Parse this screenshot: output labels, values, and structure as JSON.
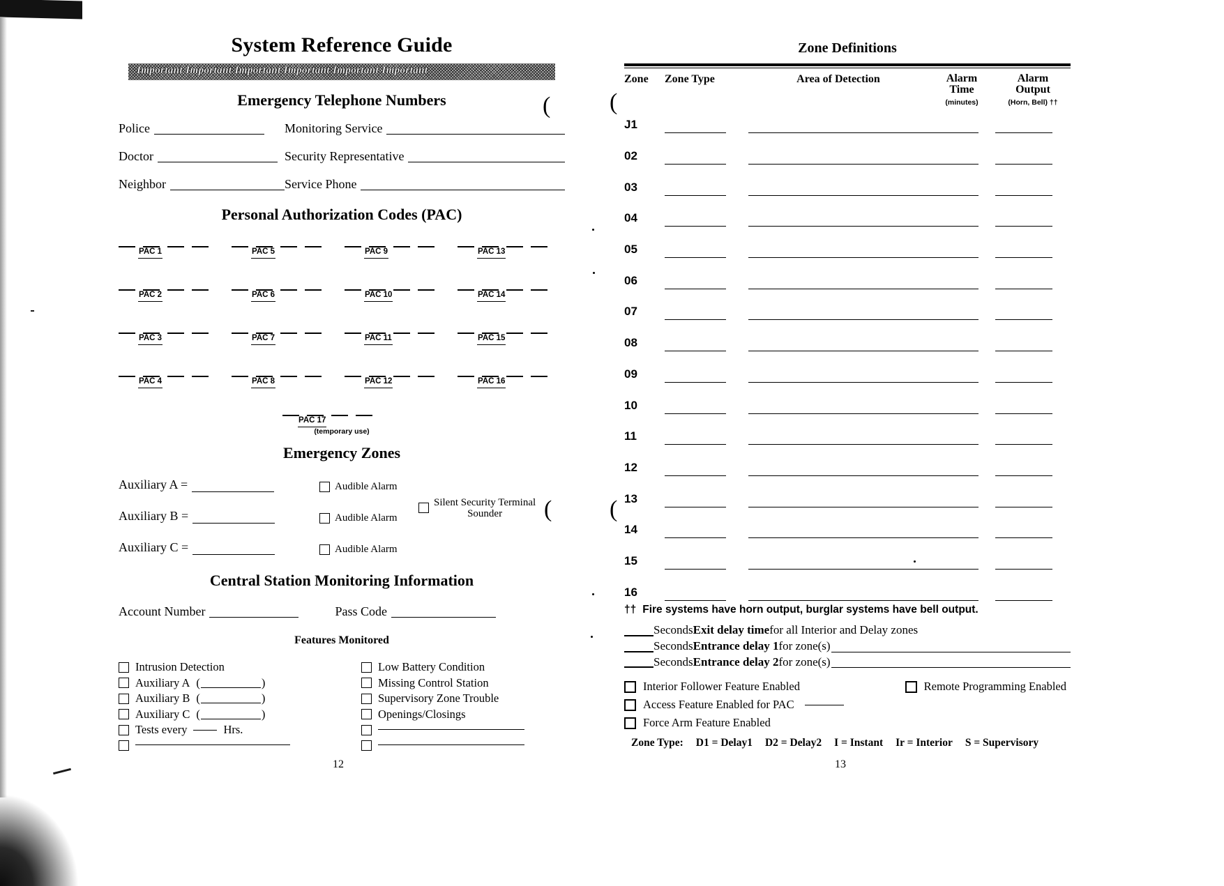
{
  "document": {
    "title": "System Reference Guide",
    "important_banner": "Important  Important  Important  Important  Important  Important",
    "page_number_left": "12",
    "page_number_right": "13"
  },
  "emergency_telephone": {
    "heading": "Emergency Telephone Numbers",
    "rows": [
      {
        "left_label": "Police",
        "right_label": "Monitoring Service"
      },
      {
        "left_label": "Doctor",
        "right_label": "Security Representative"
      },
      {
        "left_label": "Neighbor",
        "right_label": "Service Phone"
      }
    ]
  },
  "pac": {
    "heading": "Personal Authorization Codes (PAC)",
    "codes": [
      "PAC 1",
      "PAC 5",
      "PAC 9",
      "PAC 13",
      "PAC 2",
      "PAC 6",
      "PAC 10",
      "PAC 14",
      "PAC 3",
      "PAC 7",
      "PAC 11",
      "PAC 15",
      "PAC 4",
      "PAC 8",
      "PAC 12",
      "PAC 16"
    ],
    "temporary": {
      "label": "PAC 17",
      "note": "(temporary use)"
    }
  },
  "emergency_zones": {
    "heading": "Emergency Zones",
    "rows": [
      {
        "label": "Auxiliary A =",
        "checkbox1": "Audible Alarm",
        "checkbox2": null
      },
      {
        "label": "Auxiliary B =",
        "checkbox1": "Audible Alarm",
        "checkbox2_line1": "Silent Security Terminal",
        "checkbox2_line2": "Sounder"
      },
      {
        "label": "Auxiliary C =",
        "checkbox1": "Audible Alarm",
        "checkbox2": null
      }
    ]
  },
  "central_station": {
    "heading": "Central Station Monitoring Information",
    "account_number_label": "Account Number",
    "pass_code_label": "Pass Code"
  },
  "features_monitored": {
    "heading": "Features Monitored",
    "left_column": [
      {
        "label": "Intrusion Detection",
        "type": "plain"
      },
      {
        "label": "Auxiliary A",
        "type": "paren"
      },
      {
        "label": "Auxiliary B",
        "type": "paren"
      },
      {
        "label": "Auxiliary C",
        "type": "paren"
      },
      {
        "label_pre": "Tests every",
        "label_post": "Hrs.",
        "type": "inline-blank"
      },
      {
        "label": "",
        "type": "blank-line"
      }
    ],
    "right_column": [
      {
        "label": "Low Battery Condition",
        "type": "plain"
      },
      {
        "label": "Missing Control Station",
        "type": "plain"
      },
      {
        "label": "Supervisory Zone Trouble",
        "type": "plain"
      },
      {
        "label": "Openings/Closings",
        "type": "plain"
      },
      {
        "label": "",
        "type": "blank-line"
      },
      {
        "label": "",
        "type": "blank-line"
      }
    ]
  },
  "zone_definitions": {
    "heading": "Zone Definitions",
    "columns": {
      "zone": "Zone",
      "zone_type": "Zone Type",
      "area_of_detection": "Area of Detection",
      "alarm_time_line1": "Alarm",
      "alarm_time_line2": "Time",
      "alarm_time_sub": "(minutes)",
      "alarm_output_line1": "Alarm",
      "alarm_output_line2": "Output",
      "alarm_output_sub": "(Horn, Bell) ††"
    },
    "rows": [
      "J1",
      "02",
      "03",
      "04",
      "05",
      "06",
      "07",
      "08",
      "09",
      "10",
      "11",
      "12",
      "13",
      "14",
      "15",
      "16"
    ]
  },
  "footnotes": {
    "dagger_symbol": "††",
    "dagger_text": "Fire systems have horn output, burglar systems have bell output.",
    "delays": [
      {
        "pre": "Seconds ",
        "bold": "Exit delay time",
        "post": " for all Interior and Delay zones",
        "trailing_rule": false
      },
      {
        "pre": "Seconds ",
        "bold": "Entrance delay 1",
        "post": "  for zone(s)",
        "trailing_rule": true
      },
      {
        "pre": "Seconds ",
        "bold": "Entrance delay 2",
        "post": "  for zone(s)",
        "trailing_rule": true
      }
    ],
    "feature_checkboxes": [
      {
        "label": "Interior Follower Feature Enabled",
        "right_label": "Remote Programming Enabled"
      },
      {
        "label": "Access Feature Enabled for PAC",
        "has_blank": true,
        "right_label": null
      },
      {
        "label": "Force Arm Feature Enabled",
        "right_label": null
      }
    ],
    "zone_type_legend_title": "Zone Type:",
    "zone_type_legend_items": [
      "D1 = Delay1",
      "D2 = Delay2",
      "I = Instant",
      "Ir = Interior",
      "S = Supervisory"
    ]
  }
}
